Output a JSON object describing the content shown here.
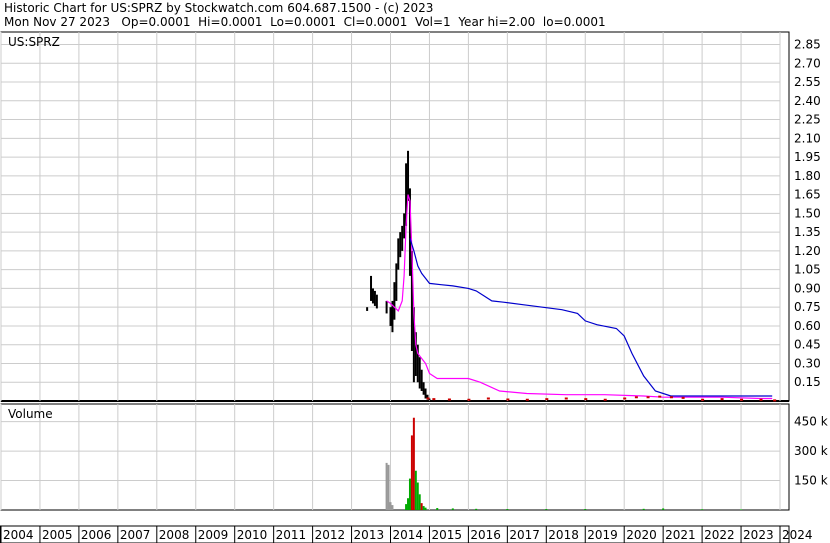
{
  "header": {
    "line1": "Historic Chart for US:SPRZ by Stockwatch.com 604.687.1500 - (c) 2023",
    "line2": "Mon Nov 27 2023   Op=0.0001  Hi=0.0001  Lo=0.0001  Cl=0.0001  Vol=1  Year hi=2.00  lo=0.0001"
  },
  "chart_data": [
    {
      "type": "line",
      "title": "US:SPRZ",
      "ylim": [
        0,
        2.95
      ],
      "y_ticks": [
        "2.85",
        "2.70",
        "2.55",
        "2.40",
        "2.25",
        "2.10",
        "1.95",
        "1.80",
        "1.65",
        "1.50",
        "1.35",
        "1.20",
        "1.05",
        "0.90",
        "0.75",
        "0.60",
        "0.45",
        "0.30",
        "0.15"
      ],
      "y_tick_values": [
        2.85,
        2.7,
        2.55,
        2.4,
        2.25,
        2.1,
        1.95,
        1.8,
        1.65,
        1.5,
        1.35,
        1.2,
        1.05,
        0.9,
        0.75,
        0.6,
        0.45,
        0.3,
        0.15
      ],
      "series": [
        {
          "color": "#000000",
          "kind": "price-bars",
          "x": [
            2013.4,
            2013.5,
            2013.55,
            2013.6,
            2013.65,
            2013.9,
            2014.0,
            2014.05,
            2014.1,
            2014.15,
            2014.2,
            2014.25,
            2014.3,
            2014.35,
            2014.4,
            2014.45,
            2014.5,
            2014.55,
            2014.6,
            2014.65,
            2014.7,
            2014.75,
            2014.8,
            2014.85,
            2014.9,
            2014.95,
            2015.0
          ],
          "high": [
            0.75,
            1.0,
            0.9,
            0.88,
            0.85,
            0.8,
            0.75,
            0.8,
            0.95,
            1.1,
            1.3,
            1.35,
            1.4,
            1.5,
            1.9,
            2.0,
            1.7,
            1.2,
            0.75,
            0.55,
            0.45,
            0.35,
            0.25,
            0.15,
            0.1,
            0.05,
            0.02
          ],
          "low": [
            0.72,
            0.8,
            0.78,
            0.76,
            0.74,
            0.7,
            0.6,
            0.55,
            0.65,
            0.8,
            1.05,
            1.15,
            1.2,
            1.3,
            1.4,
            1.6,
            1.0,
            0.4,
            0.15,
            0.2,
            0.15,
            0.1,
            0.08,
            0.05,
            0.02,
            0.01,
            0.005
          ]
        },
        {
          "color": "#ff00ff",
          "kind": "moving-average-short",
          "x": [
            2013.9,
            2014.0,
            2014.1,
            2014.2,
            2014.3,
            2014.35,
            2014.4,
            2014.45,
            2014.5,
            2014.55,
            2014.6,
            2014.65,
            2014.7,
            2014.8,
            2014.9,
            2015.0,
            2015.2,
            2015.4,
            2015.6,
            2015.8,
            2016.0,
            2016.3,
            2016.8,
            2017.5,
            2018.5,
            2019.5,
            2020.5,
            2021.0,
            2021.5,
            2022.5,
            2023.5,
            2023.8
          ],
          "values": [
            0.8,
            0.78,
            0.75,
            0.72,
            0.8,
            1.0,
            1.4,
            1.65,
            1.6,
            1.2,
            0.7,
            0.45,
            0.38,
            0.34,
            0.3,
            0.22,
            0.18,
            0.18,
            0.18,
            0.18,
            0.18,
            0.15,
            0.08,
            0.06,
            0.05,
            0.05,
            0.04,
            0.03,
            0.03,
            0.03,
            0.02,
            0.02
          ]
        },
        {
          "color": "#0000cc",
          "kind": "moving-average-long",
          "x": [
            2014.5,
            2014.6,
            2014.7,
            2014.8,
            2014.9,
            2015.0,
            2015.3,
            2015.6,
            2016.0,
            2016.2,
            2016.4,
            2016.6,
            2016.9,
            2017.4,
            2017.9,
            2018.4,
            2018.8,
            2019.0,
            2019.3,
            2019.8,
            2020.0,
            2020.2,
            2020.5,
            2020.8,
            2021.2,
            2022.0,
            2023.0,
            2023.8
          ],
          "values": [
            1.3,
            1.2,
            1.08,
            1.02,
            0.98,
            0.94,
            0.93,
            0.92,
            0.9,
            0.88,
            0.84,
            0.8,
            0.79,
            0.77,
            0.75,
            0.73,
            0.7,
            0.64,
            0.61,
            0.58,
            0.52,
            0.38,
            0.2,
            0.08,
            0.04,
            0.04,
            0.04,
            0.04
          ]
        },
        {
          "color": "#cc0000",
          "kind": "price-bars-down",
          "x": [
            2014.95,
            2015.1,
            2015.5,
            2016.0,
            2016.5,
            2017.0,
            2017.5,
            2018.0,
            2018.5,
            2019.0,
            2019.5,
            2020.0,
            2020.3,
            2020.6,
            2020.9,
            2021.2,
            2021.5,
            2022.0,
            2022.5,
            2023.0,
            2023.5,
            2023.85
          ],
          "values": [
            0.02,
            0.015,
            0.012,
            0.01,
            0.02,
            0.012,
            0.01,
            0.015,
            0.02,
            0.015,
            0.01,
            0.02,
            0.03,
            0.03,
            0.035,
            0.03,
            0.025,
            0.01,
            0.015,
            0.01,
            0.01,
            0.005
          ]
        }
      ]
    },
    {
      "type": "bar",
      "title": "Volume",
      "ylim": [
        0,
        540
      ],
      "y_ticks": [
        "450 k",
        "300 k",
        "150 k"
      ],
      "y_tick_values": [
        450,
        300,
        150
      ],
      "bars": [
        {
          "x": 2013.9,
          "value": 240,
          "color": "#999999"
        },
        {
          "x": 2013.95,
          "value": 230,
          "color": "#999999"
        },
        {
          "x": 2014.0,
          "value": 40,
          "color": "#999999"
        },
        {
          "x": 2014.05,
          "value": 25,
          "color": "#999999"
        },
        {
          "x": 2014.4,
          "value": 30,
          "color": "#00aa00"
        },
        {
          "x": 2014.45,
          "value": 60,
          "color": "#00aa00"
        },
        {
          "x": 2014.5,
          "value": 160,
          "color": "#00aa00"
        },
        {
          "x": 2014.55,
          "value": 380,
          "color": "#cc0000"
        },
        {
          "x": 2014.6,
          "value": 470,
          "color": "#cc0000"
        },
        {
          "x": 2014.65,
          "value": 200,
          "color": "#00aa00"
        },
        {
          "x": 2014.7,
          "value": 140,
          "color": "#00aa00"
        },
        {
          "x": 2014.75,
          "value": 80,
          "color": "#00aa00"
        },
        {
          "x": 2014.8,
          "value": 35,
          "color": "#cc0000"
        },
        {
          "x": 2014.85,
          "value": 20,
          "color": "#00aa00"
        },
        {
          "x": 2014.9,
          "value": 12,
          "color": "#00aa00"
        },
        {
          "x": 2015.2,
          "value": 10,
          "color": "#00aa00"
        },
        {
          "x": 2015.6,
          "value": 8,
          "color": "#00aa00"
        },
        {
          "x": 2016.2,
          "value": 6,
          "color": "#00aa00"
        },
        {
          "x": 2017.0,
          "value": 5,
          "color": "#00aa00"
        },
        {
          "x": 2018.0,
          "value": 5,
          "color": "#00aa00"
        },
        {
          "x": 2019.0,
          "value": 5,
          "color": "#00aa00"
        },
        {
          "x": 2020.5,
          "value": 6,
          "color": "#00aa00"
        },
        {
          "x": 2021.0,
          "value": 8,
          "color": "#00aa00"
        },
        {
          "x": 2022.0,
          "value": 4,
          "color": "#00aa00"
        },
        {
          "x": 2023.0,
          "value": 3,
          "color": "#00aa00"
        }
      ]
    }
  ],
  "x_axis": {
    "labels": [
      "2004",
      "2005",
      "2006",
      "2007",
      "2008",
      "2009",
      "2010",
      "2011",
      "2012",
      "2013",
      "2014",
      "2015",
      "2016",
      "2017",
      "2018",
      "2019",
      "2020",
      "2021",
      "2022",
      "2023",
      "2024"
    ],
    "years": [
      2004,
      2005,
      2006,
      2007,
      2008,
      2009,
      2010,
      2011,
      2012,
      2013,
      2014,
      2015,
      2016,
      2017,
      2018,
      2019,
      2020,
      2021,
      2022,
      2023,
      2024
    ]
  }
}
